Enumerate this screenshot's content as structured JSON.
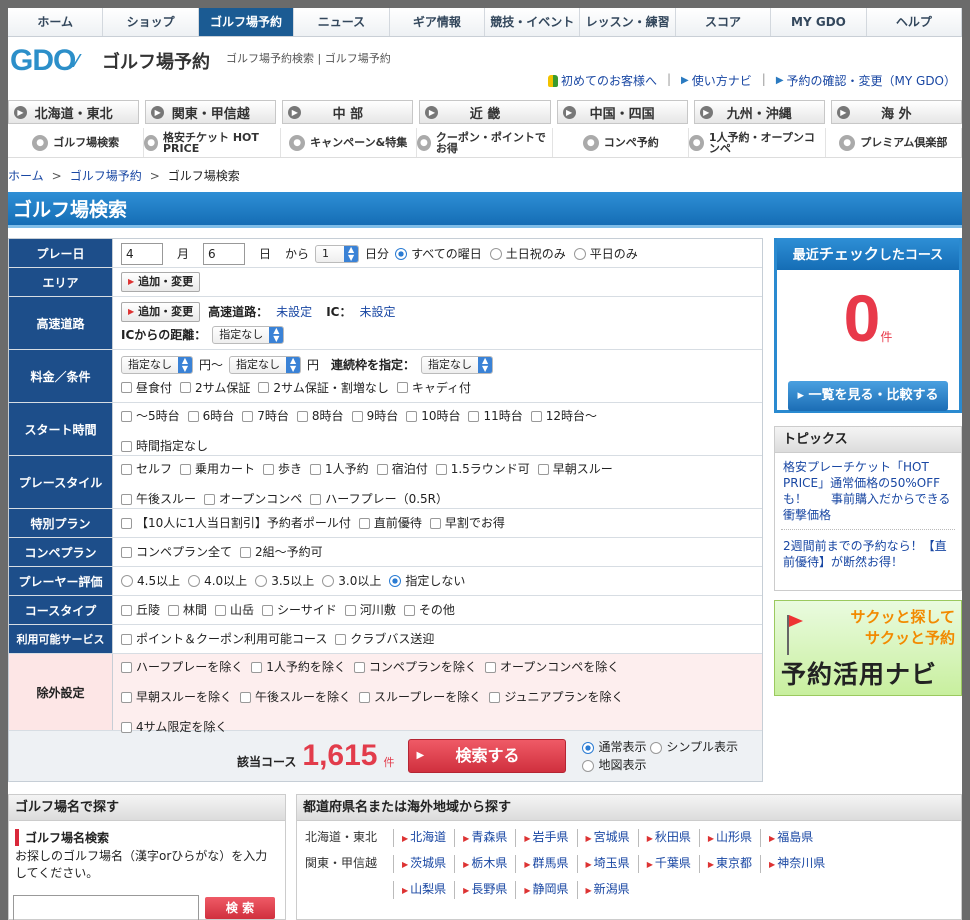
{
  "topnav": [
    {
      "label": "ホーム"
    },
    {
      "label": "ショップ"
    },
    {
      "label": "ゴルフ場予約",
      "active": true
    },
    {
      "label": "ニュース"
    },
    {
      "label": "ギア情報"
    },
    {
      "label": "競技・イベント"
    },
    {
      "label": "レッスン・練習"
    },
    {
      "label": "スコア"
    },
    {
      "label": "MY GDO"
    },
    {
      "label": "ヘルプ"
    }
  ],
  "header": {
    "logo": "GDO",
    "site_name": "ゴルフ場予約",
    "crumb_text": "ゴルフ場予約検索 | ゴルフ場予約",
    "links": [
      "初めてのお客様へ",
      "使い方ナビ",
      "予約の確認・変更（MY GDO）"
    ]
  },
  "regions": [
    "北海道・東北",
    "関東・甲信越",
    "中 部",
    "近 畿",
    "中国・四国",
    "九州・沖縄",
    "海 外"
  ],
  "subnav": [
    {
      "label": "ゴルフ場検索",
      "icon": "search-icon"
    },
    {
      "label": "格安チケット HOT PRICE",
      "icon": "ticket-icon"
    },
    {
      "label": "キャンペーン&特集",
      "icon": "campaign-icon"
    },
    {
      "label": "クーポン・ポイントでお得",
      "icon": "coupon-icon"
    },
    {
      "label": "コンペ予約",
      "icon": "group-icon"
    },
    {
      "label": "1人予約・オープンコンペ",
      "icon": "single-person-icon"
    },
    {
      "label": "プレミアム倶楽部",
      "icon": "premium-icon"
    }
  ],
  "breadcrumb": [
    "ホーム",
    "ゴルフ場予約",
    "ゴルフ場検索"
  ],
  "page_title": "ゴルフ場検索",
  "form": {
    "play_date": {
      "label": "プレー日",
      "month": "4",
      "month_unit": "月",
      "day": "6",
      "day_unit": "日",
      "from": "から",
      "days": "1",
      "days_unit": "日分",
      "options": [
        "すべての曜日",
        "土日祝のみ",
        "平日のみ"
      ],
      "selected": 0
    },
    "area": {
      "label": "エリア",
      "button": "追加・変更"
    },
    "highway": {
      "label": "高速道路",
      "button": "追加・変更",
      "highway_label": "高速道路：",
      "highway_value": "未設定",
      "ic_label": "IC：",
      "ic_value": "未設定",
      "distance_label": "ICからの距離：",
      "distance_value": "指定なし"
    },
    "price": {
      "label": "料金／条件",
      "min": "指定なし",
      "from": "円〜",
      "max": "指定なし",
      "yen": "円",
      "slots_label": "連続枠を指定：",
      "slots": "指定なし",
      "checks": [
        "昼食付",
        "2サム保証",
        "2サム保証・割増なし",
        "キャディ付"
      ]
    },
    "start_time": {
      "label": "スタート時間",
      "checks": [
        "〜5時台",
        "6時台",
        "7時台",
        "8時台",
        "9時台",
        "10時台",
        "11時台",
        "12時台〜",
        "時間指定なし"
      ]
    },
    "play_style": {
      "label": "プレースタイル",
      "checks": [
        "セルフ",
        "乗用カート",
        "歩き",
        "1人予約",
        "宿泊付",
        "1.5ラウンド可",
        "早朝スルー",
        "午後スルー",
        "オープンコンペ",
        "ハーフプレー（0.5R）"
      ]
    },
    "special_plan": {
      "label": "特別プラン",
      "checks": [
        "【10人に1人当日割引】予約者ポール付",
        "直前優待",
        "早割でお得"
      ]
    },
    "compe_plan": {
      "label": "コンペプラン",
      "checks": [
        "コンペプラン全て",
        "2組〜予約可"
      ]
    },
    "rating": {
      "label": "プレーヤー評価",
      "options": [
        "4.5以上",
        "4.0以上",
        "3.5以上",
        "3.0以上",
        "指定しない"
      ],
      "selected": 4
    },
    "course_type": {
      "label": "コースタイプ",
      "checks": [
        "丘陵",
        "林間",
        "山岳",
        "シーサイド",
        "河川敷",
        "その他"
      ]
    },
    "services": {
      "label": "利用可能サービス",
      "checks": [
        "ポイント＆クーポン利用可能コース",
        "クラブバス送迎"
      ]
    },
    "exclude": {
      "label": "除外設定",
      "checks": [
        "ハーフプレーを除く",
        "1人予約を除く",
        "コンペプランを除く",
        "オープンコンペを除く",
        "早朝スルーを除く",
        "午後スルーを除く",
        "スループレーを除く",
        "ジュニアプランを除く",
        "4サム限定を除く"
      ]
    },
    "result": {
      "label": "該当コース",
      "count": "1,615",
      "unit": "件",
      "search_button": "検索する",
      "views": [
        "通常表示",
        "シンプル表示",
        "地図表示"
      ],
      "selected_view": 0
    }
  },
  "recent": {
    "title_a": "最近",
    "title_b": "チェック",
    "title_c": "したコース",
    "count": "0",
    "unit": "件",
    "button": "一覧を見る・比較する"
  },
  "topics": {
    "title": "トピックス",
    "items": [
      "格安プレーチケット「HOT PRICE」通常価格の50%OFFも！　　事前購入だからできる衝撃価格",
      "2週間前までの予約なら！【直前優待】が断然お得！"
    ]
  },
  "banner": {
    "line1": "サクッと探して",
    "line2": "サクッと予約",
    "line3": "予約活用ナビ"
  },
  "name_search": {
    "title": "ゴルフ場名で探す",
    "subtitle": "ゴルフ場名検索",
    "desc": "お探しのゴルフ場名（漢字orひらがな）を入力してください。",
    "button": "検 索"
  },
  "pref_search": {
    "title": "都道府県名または海外地域から探す",
    "rows": [
      {
        "region": "北海道・東北",
        "prefs": [
          "北海道",
          "青森県",
          "岩手県",
          "宮城県",
          "秋田県",
          "山形県",
          "福島県"
        ]
      },
      {
        "region": "関東・甲信越",
        "prefs": [
          "茨城県",
          "栃木県",
          "群馬県",
          "埼玉県",
          "千葉県",
          "東京都",
          "神奈川県"
        ]
      },
      {
        "region": "",
        "prefs": [
          "山梨県",
          "長野県",
          "静岡県",
          "新潟県"
        ]
      }
    ]
  },
  "colors": {
    "brand_blue": "#1b5b93",
    "accent_red": "#e23c4b",
    "label_navy": "#1d4e8a"
  }
}
